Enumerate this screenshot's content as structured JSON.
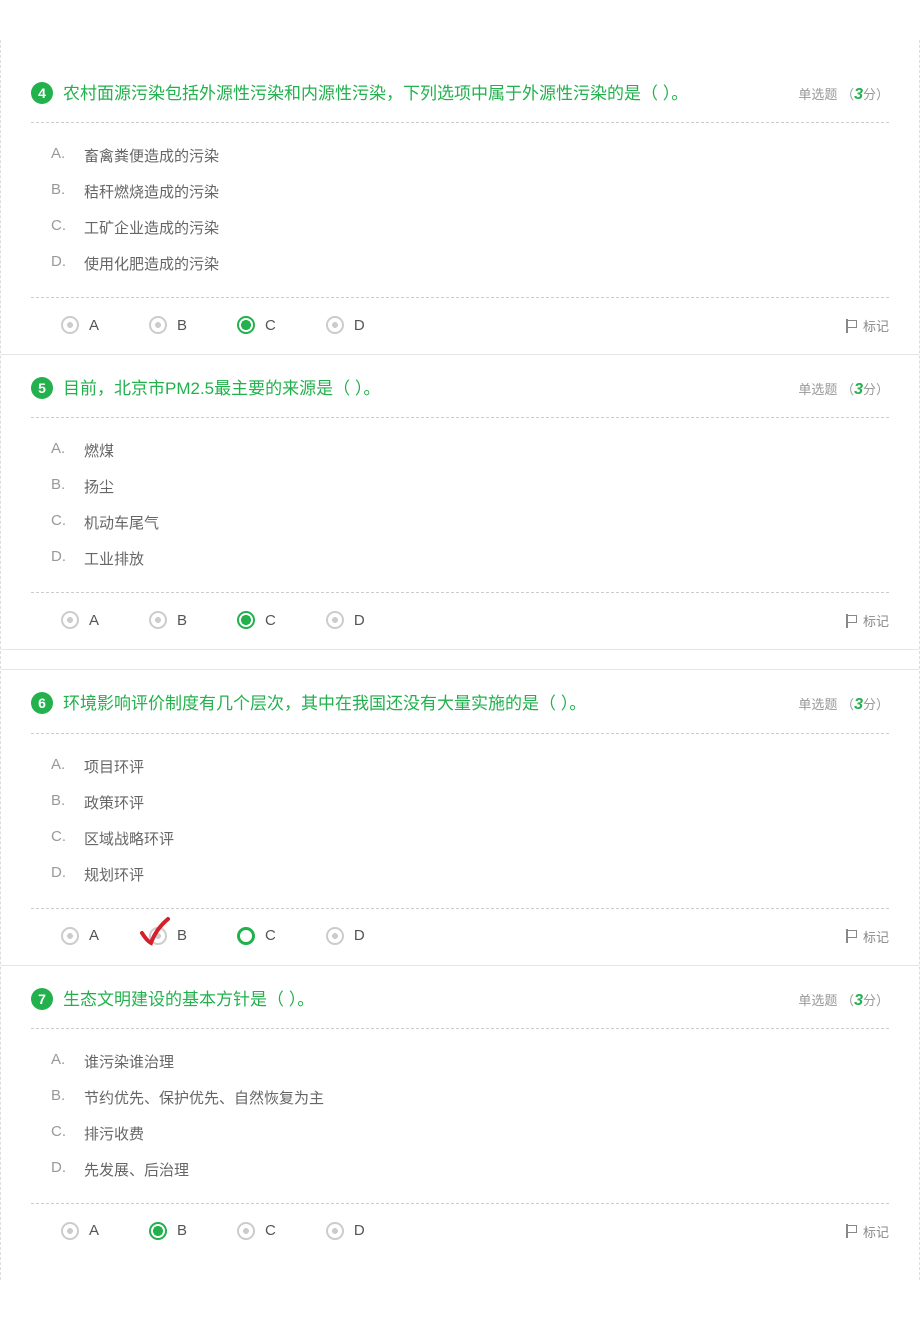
{
  "meta": {
    "type_label": "单选题",
    "score_prefix": "（",
    "score_value": "3",
    "score_suffix": "分）",
    "mark_label": "标记"
  },
  "radio_letters": [
    "A",
    "B",
    "C",
    "D"
  ],
  "questions": [
    {
      "number": "4",
      "text": "农村面源污染包括外源性污染和内源性污染，下列选项中属于外源性污染的是（ ）。",
      "options": [
        {
          "letter": "A.",
          "text": "畜禽粪便造成的污染"
        },
        {
          "letter": "B.",
          "text": "秸秆燃烧造成的污染"
        },
        {
          "letter": "C.",
          "text": "工矿企业造成的污染"
        },
        {
          "letter": "D.",
          "text": "使用化肥造成的污染"
        }
      ],
      "selected": "C",
      "style": "dot"
    },
    {
      "number": "5",
      "text": "目前，北京市PM2.5最主要的来源是（ ）。",
      "options": [
        {
          "letter": "A.",
          "text": "燃煤"
        },
        {
          "letter": "B.",
          "text": "扬尘"
        },
        {
          "letter": "C.",
          "text": "机动车尾气"
        },
        {
          "letter": "D.",
          "text": "工业排放"
        }
      ],
      "selected": "C",
      "style": "dot"
    },
    {
      "number": "6",
      "text": "环境影响评价制度有几个层次，其中在我国还没有大量实施的是（ ）。",
      "options": [
        {
          "letter": "A.",
          "text": "项目环评"
        },
        {
          "letter": "B.",
          "text": "政策环评"
        },
        {
          "letter": "C.",
          "text": "区域战略环评"
        },
        {
          "letter": "D.",
          "text": "规划环评"
        }
      ],
      "selected": "C",
      "style": "ring",
      "hand_check": "B"
    },
    {
      "number": "7",
      "text": "生态文明建设的基本方针是（ ）。",
      "options": [
        {
          "letter": "A.",
          "text": "谁污染谁治理"
        },
        {
          "letter": "B.",
          "text": "节约优先、保护优先、自然恢复为主"
        },
        {
          "letter": "C.",
          "text": "排污收费"
        },
        {
          "letter": "D.",
          "text": "先发展、后治理"
        }
      ],
      "selected": "B",
      "style": "dot"
    }
  ]
}
